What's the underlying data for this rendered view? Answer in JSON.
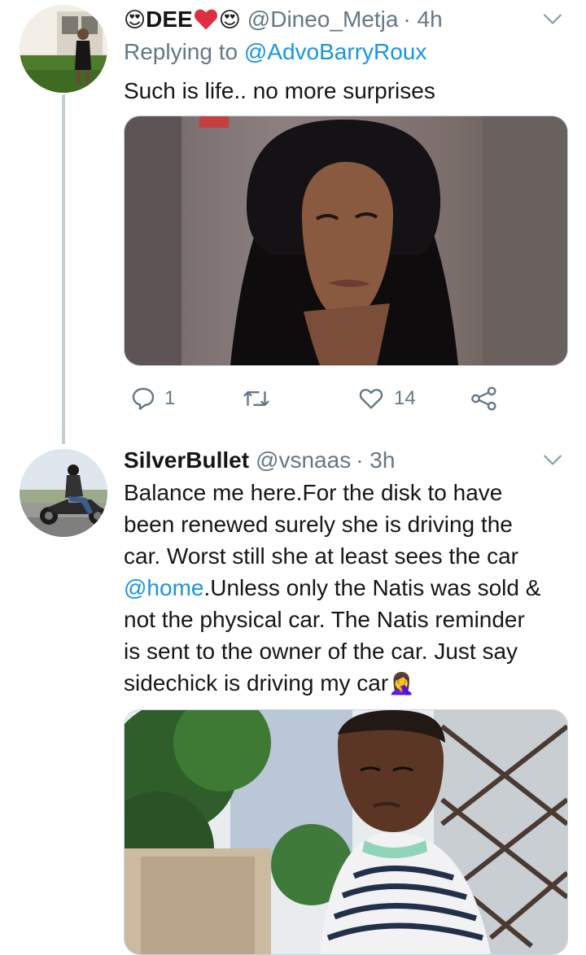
{
  "tweet1": {
    "emoji_prefix": "😍",
    "display_name": "DEE",
    "emoji_suffix": "😍",
    "handle": "@Dineo_Metja",
    "time": "· 4h",
    "replying_prefix": "Replying to ",
    "replying_to": "@AdvoBarryRoux",
    "text": "Such is life.. no more surprises",
    "replies": "1",
    "retweets": "",
    "likes": "14"
  },
  "tweet2": {
    "display_name": "SilverBullet",
    "handle": "@vsnaas",
    "time": "· 3h",
    "text_lines": [
      "Balance me here.For the disk to have",
      "been renewed surely she is driving the",
      "car. Worst still she at least sees the car"
    ],
    "mention": "@home",
    "text_after_mention": ".Unless only the Natis was sold &",
    "text_lines_2": [
      "not the physical car. The Natis reminder",
      "is sent to the owner of the car. Just say"
    ],
    "last_line": "sidechick is driving my car",
    "trailing_emoji": "🤦‍♀️"
  },
  "colors": {
    "link": "#1b95e0",
    "secondary_text": "#657786",
    "thread_line": "#c4cfd6",
    "heart": "#e0245e"
  },
  "icons": [
    "reply-icon",
    "retweet-icon",
    "like-icon",
    "share-icon",
    "chevron-down-icon"
  ]
}
